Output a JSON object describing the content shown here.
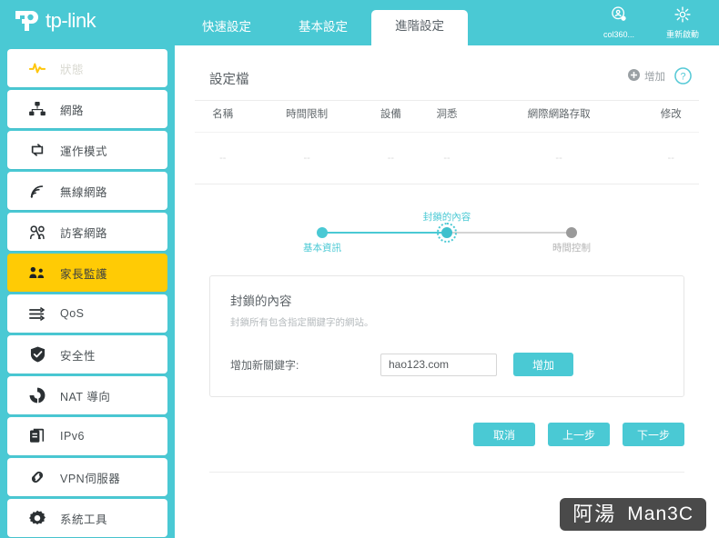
{
  "brand": {
    "name": "tp-link"
  },
  "tabs": [
    {
      "label": "快速設定",
      "active": false
    },
    {
      "label": "基本設定",
      "active": false
    },
    {
      "label": "進階設定",
      "active": true
    }
  ],
  "top_actions": [
    {
      "label": "col360...",
      "icon": "account-icon"
    },
    {
      "label": "重新啟動",
      "icon": "reboot-icon"
    }
  ],
  "sidebar": {
    "items": [
      {
        "label": "狀態",
        "icon": "pulse-icon",
        "state": "status"
      },
      {
        "label": "網路",
        "icon": "network-icon",
        "state": "normal"
      },
      {
        "label": "運作模式",
        "icon": "operation-mode-icon",
        "state": "normal"
      },
      {
        "label": "無線網路",
        "icon": "wireless-icon",
        "state": "normal"
      },
      {
        "label": "訪客網路",
        "icon": "guest-network-icon",
        "state": "normal"
      },
      {
        "label": "家長監護",
        "icon": "parental-control-icon",
        "state": "active"
      },
      {
        "label": "QoS",
        "icon": "qos-icon",
        "state": "normal"
      },
      {
        "label": "安全性",
        "icon": "security-shield-icon",
        "state": "normal"
      },
      {
        "label": "NAT 導向",
        "icon": "nat-forwarding-icon",
        "state": "normal"
      },
      {
        "label": "IPv6",
        "icon": "ipv6-icon",
        "state": "normal"
      },
      {
        "label": "VPN伺服器",
        "icon": "vpn-link-icon",
        "state": "normal"
      },
      {
        "label": "系統工具",
        "icon": "system-tools-gear-icon",
        "state": "normal"
      }
    ]
  },
  "panel": {
    "title": "設定檔",
    "add_label": "增加",
    "help_label": "?",
    "table": {
      "headers": [
        "名稱",
        "時間限制",
        "設備",
        "洞悉",
        "網際網路存取",
        "修改"
      ],
      "rows": [
        [
          "--",
          "--",
          "--",
          "--",
          "--",
          "--"
        ]
      ]
    }
  },
  "stepper": {
    "steps": [
      {
        "label": "基本資訊",
        "state": "done"
      },
      {
        "label": "封鎖的內容",
        "state": "current"
      },
      {
        "label": "時間控制",
        "state": "pending"
      }
    ]
  },
  "block_card": {
    "title": "封鎖的內容",
    "subtitle": "封鎖所有包含指定關鍵字的網站。",
    "keyword_label": "增加新關鍵字:",
    "keyword_value": "hao123.com",
    "keyword_placeholder": "",
    "add_button": "增加"
  },
  "footer": {
    "cancel": "取消",
    "previous": "上一步",
    "next": "下一步"
  },
  "watermark": {
    "cn": "阿湯",
    "en": "Man3C"
  },
  "colors": {
    "brand_teal": "#4ac9d4",
    "active_yellow": "#ffcb05",
    "status_yellow": "#ffc60b",
    "text_gray": "#5a6065"
  }
}
